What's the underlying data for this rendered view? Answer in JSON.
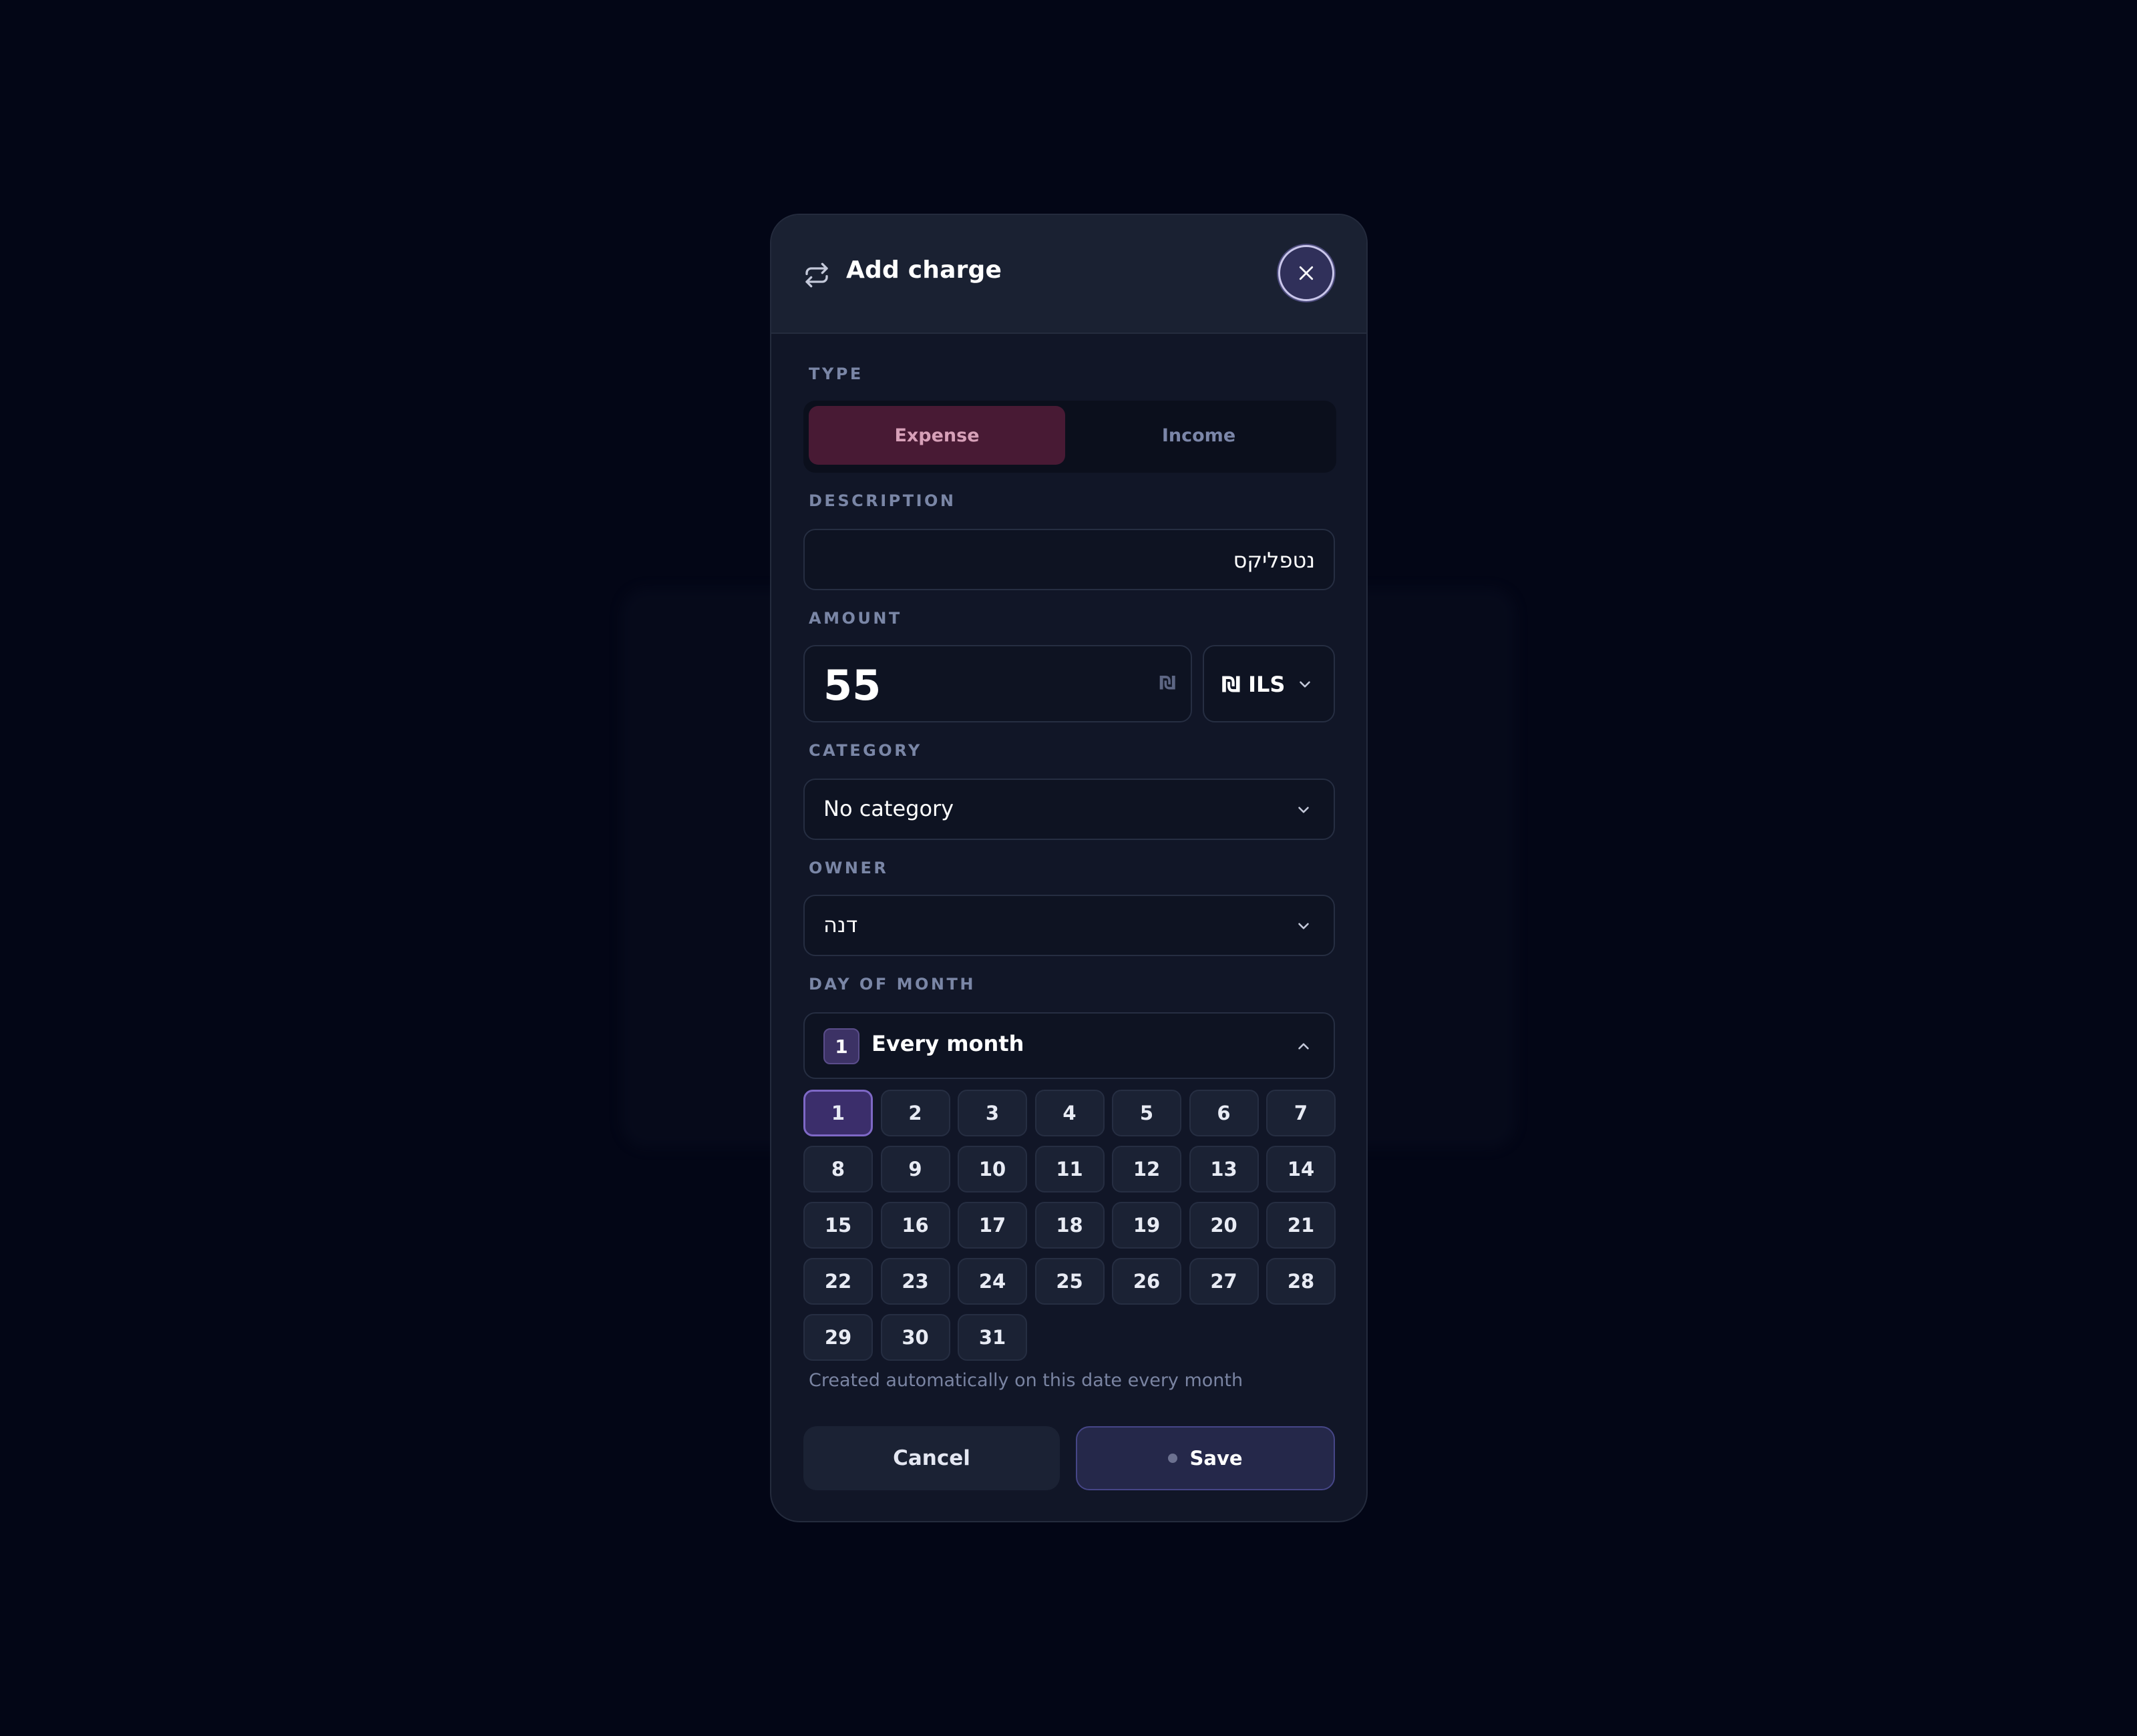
{
  "header": {
    "title": "Add charge",
    "icon": "repeat-icon",
    "close_icon": "close-icon"
  },
  "type": {
    "label": "TYPE",
    "options": [
      "Expense",
      "Income"
    ],
    "selected": "Expense"
  },
  "description": {
    "label": "DESCRIPTION",
    "value": "נטפליקס"
  },
  "amount": {
    "label": "AMOUNT",
    "value": "55",
    "suffix": "₪",
    "currency": "₪ ILS"
  },
  "category": {
    "label": "CATEGORY",
    "value": "No category"
  },
  "owner": {
    "label": "OWNER",
    "value": "דנה"
  },
  "day_of_month": {
    "label": "DAY OF MONTH",
    "selected_day": "1",
    "summary": "Every month",
    "days": [
      "1",
      "2",
      "3",
      "4",
      "5",
      "6",
      "7",
      "8",
      "9",
      "10",
      "11",
      "12",
      "13",
      "14",
      "15",
      "16",
      "17",
      "18",
      "19",
      "20",
      "21",
      "22",
      "23",
      "24",
      "25",
      "26",
      "27",
      "28",
      "29",
      "30",
      "31"
    ],
    "hint": "Created automatically on this date every month"
  },
  "actions": {
    "cancel": "Cancel",
    "save": "Save"
  },
  "colors": {
    "background": "#030616",
    "modal": "#111627",
    "expense_accent": "#481a34",
    "selected_day": "#3b2e6b"
  }
}
